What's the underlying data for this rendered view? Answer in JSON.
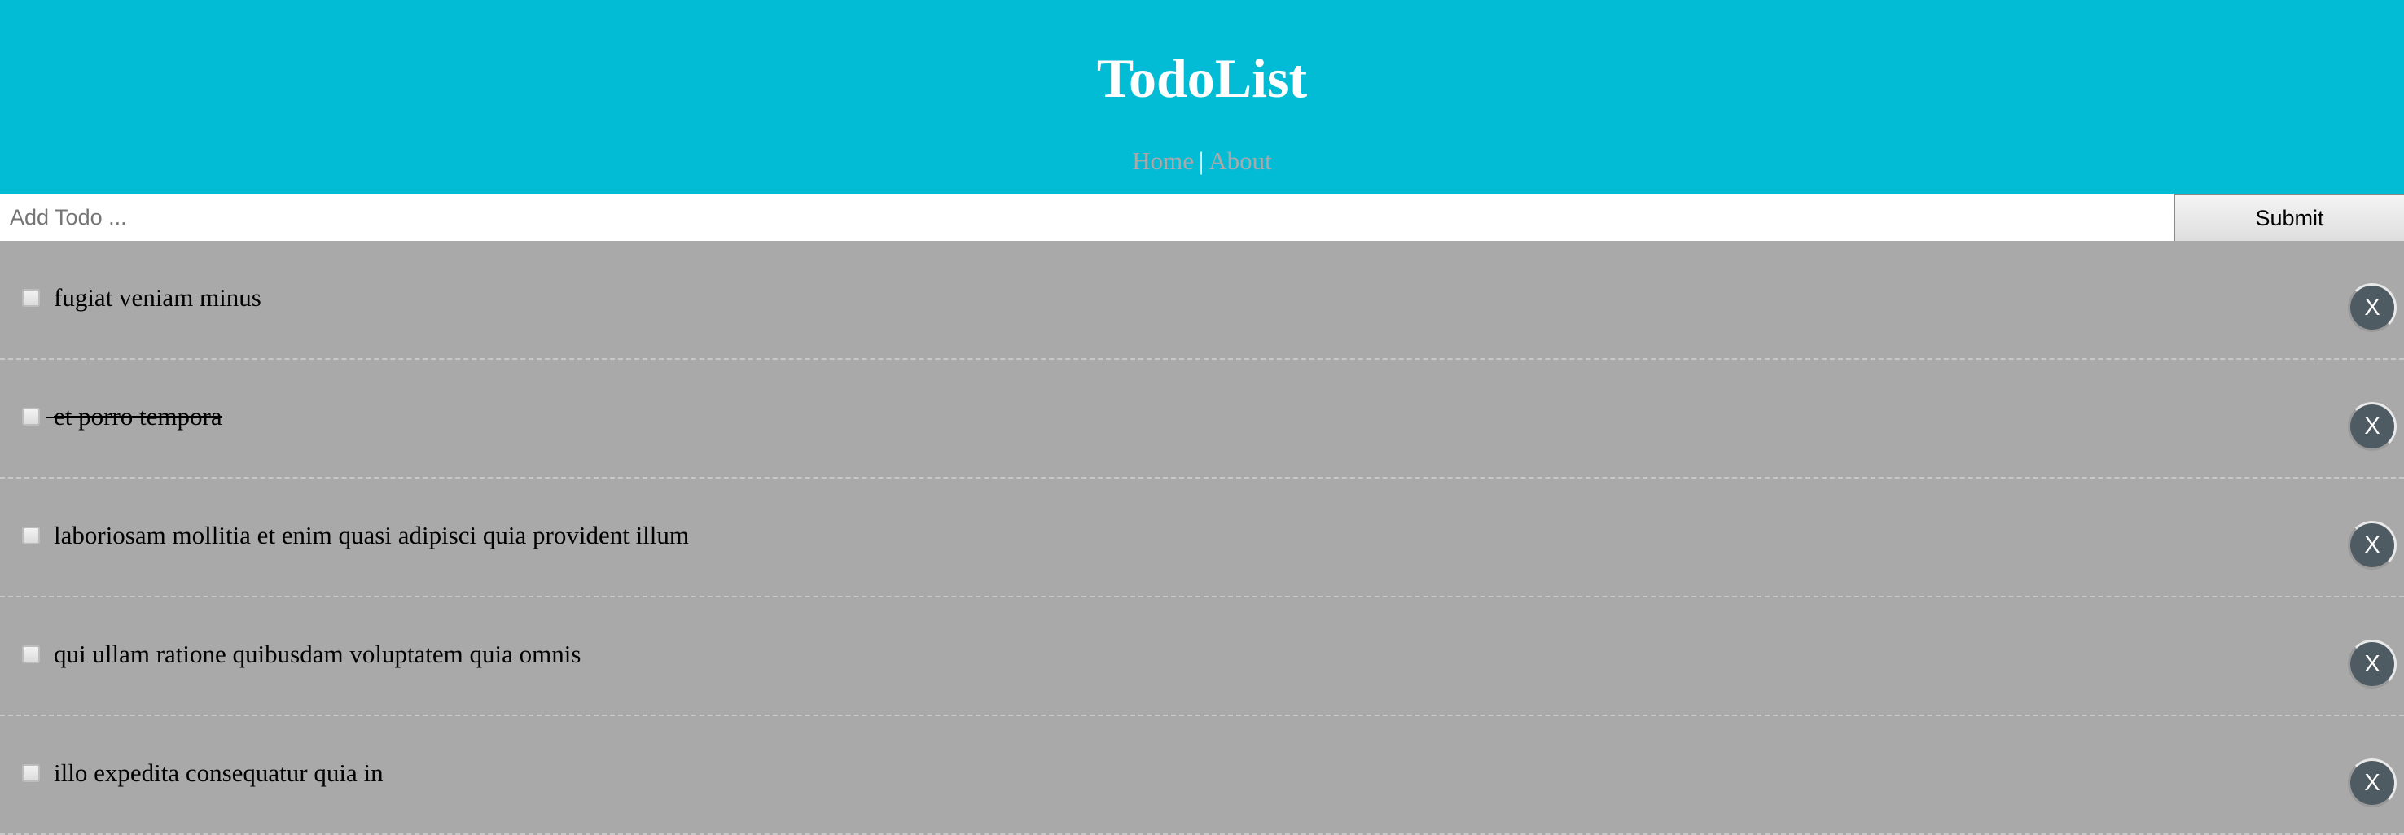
{
  "header": {
    "title": "TodoList",
    "nav": {
      "home": "Home",
      "separator": "|",
      "about": "About"
    }
  },
  "add_form": {
    "placeholder": "Add Todo ...",
    "value": "",
    "submit_label": "Submit"
  },
  "todos": [
    {
      "title": "fugiat veniam minus",
      "completed": false,
      "delete_label": "X"
    },
    {
      "title": "et porro tempora",
      "completed": true,
      "delete_label": "X"
    },
    {
      "title": "laboriosam mollitia et enim quasi adipisci quia provident illum",
      "completed": false,
      "delete_label": "X"
    },
    {
      "title": "qui ullam ratione quibusdam voluptatem quia omnis",
      "completed": false,
      "delete_label": "X"
    },
    {
      "title": "illo expedita consequatur quia in",
      "completed": false,
      "delete_label": "X"
    }
  ],
  "colors": {
    "header_bg": "#02bcd6",
    "list_bg": "#a9a9a9",
    "delete_button_bg": "#4e5b63",
    "nav_link": "#a9a9a9"
  }
}
